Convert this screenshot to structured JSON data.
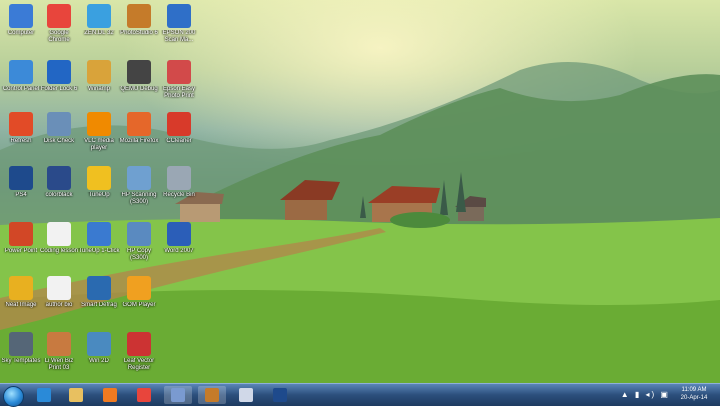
{
  "desktop": {
    "icons": [
      {
        "label": "Computer",
        "icon": "computer-icon",
        "color": "#3b7bd6"
      },
      {
        "label": "Google Chrome",
        "icon": "chrome-icon",
        "color": "#e8453c"
      },
      {
        "label": "ZEN.DL 32",
        "icon": "app-icon",
        "color": "#3aa0e0"
      },
      {
        "label": "PhotoStudio 6",
        "icon": "photostudio-icon",
        "color": "#c57b2a"
      },
      {
        "label": "EPSON 200 Scan Ma...",
        "icon": "epson-scan-icon",
        "color": "#2f6fc8"
      },
      {
        "label": "Control Panel",
        "icon": "control-panel-icon",
        "color": "#3c8ad8"
      },
      {
        "label": "Folder Lock 6",
        "icon": "folder-lock-icon",
        "color": "#2266c4"
      },
      {
        "label": "Winamp",
        "icon": "winamp-icon",
        "color": "#d9a33a"
      },
      {
        "label": "QEMU Debug",
        "icon": "debug-icon",
        "color": "#444444"
      },
      {
        "label": "Epson Easy Photo Print",
        "icon": "photo-print-icon",
        "color": "#d24a4a"
      },
      {
        "label": "Refresh",
        "icon": "windows-icon",
        "color": "#e24b27"
      },
      {
        "label": "Disk Check",
        "icon": "disk-check-icon",
        "color": "#6a8fb8"
      },
      {
        "label": "VLC media player",
        "icon": "vlc-icon",
        "color": "#f08a00"
      },
      {
        "label": "Mozilla Firefox",
        "icon": "firefox-icon",
        "color": "#e5672a"
      },
      {
        "label": "CCleaner",
        "icon": "ccleaner-icon",
        "color": "#d83a2a"
      },
      {
        "label": "PS4",
        "icon": "photoshop-icon",
        "color": "#1e4a8c"
      },
      {
        "label": "colorblack",
        "icon": "image-icon",
        "color": "#2a4a8a"
      },
      {
        "label": "TuneUp",
        "icon": "tuneup-icon",
        "color": "#f0c020"
      },
      {
        "label": "HP Scanning (S300)",
        "icon": "scanner-icon",
        "color": "#6fa0d0"
      },
      {
        "label": "Recycle Bin",
        "icon": "recycle-bin-icon",
        "color": "#9aa7b4"
      },
      {
        "label": "Power Point",
        "icon": "powerpoint-icon",
        "color": "#d24726"
      },
      {
        "label": "Coding lesson",
        "icon": "document-icon",
        "color": "#f2f2f2"
      },
      {
        "label": "TuneUp 1-Click",
        "icon": "tuneup-icon",
        "color": "#3a7ad0"
      },
      {
        "label": "HP Copy (S300)",
        "icon": "copier-icon",
        "color": "#5a8ac0"
      },
      {
        "label": "Word 2007",
        "icon": "word-icon",
        "color": "#2b5eb8"
      },
      {
        "label": "Neat Image",
        "icon": "neat-image-icon",
        "color": "#e8b020"
      },
      {
        "label": "author bio",
        "icon": "document-icon",
        "color": "#f2f2f2"
      },
      {
        "label": "Smart Defrag",
        "icon": "defrag-icon",
        "color": "#2a6ab0"
      },
      {
        "label": "GOM Player",
        "icon": "gom-player-icon",
        "color": "#f0a020"
      },
      {
        "label": "Sky Templates",
        "icon": "app-icon",
        "color": "#556677"
      },
      {
        "label": "Li Wen Biz Print 03",
        "icon": "portrait-icon",
        "color": "#c87a40"
      },
      {
        "label": "Win 2D",
        "icon": "app-icon",
        "color": "#4a8ac0"
      },
      {
        "label": "Leaf Vector Register",
        "icon": "app-icon",
        "color": "#cc3333"
      }
    ]
  },
  "taskbar": {
    "clock_time": "11:09 AM",
    "clock_date": "20-Apr-14",
    "tray_text": "▲ ▮ ◂) ▣",
    "buttons": [
      {
        "icon": "internet-explorer-icon",
        "color": "#2a8ad8"
      },
      {
        "icon": "explorer-folder-icon",
        "color": "#e8c060"
      },
      {
        "icon": "media-player-icon",
        "color": "#f07a20"
      },
      {
        "icon": "chrome-icon",
        "color": "#e8453c"
      },
      {
        "icon": "paint-icon",
        "color": "#7a9ad0"
      },
      {
        "icon": "photostudio-icon",
        "color": "#c57b2a"
      },
      {
        "icon": "notepad-icon",
        "color": "#d0d8e8"
      },
      {
        "icon": "photoshop-icon",
        "color": "#1e4a8c"
      }
    ]
  }
}
